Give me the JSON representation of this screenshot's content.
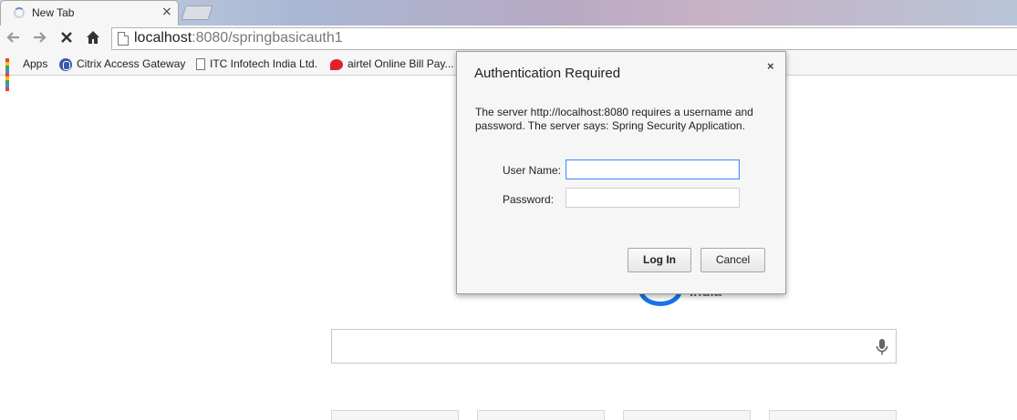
{
  "tab": {
    "title": "New Tab",
    "close": "×"
  },
  "toolbar": {
    "back_icon": "arrow-left-icon",
    "forward_icon": "arrow-right-icon",
    "stop_icon": "stop-icon",
    "home_icon": "home-icon",
    "url_host": "localhost",
    "url_rest": ":8080/springbasicauth1"
  },
  "bookmarks": [
    {
      "label": "Apps",
      "icon": "apps-grid-icon"
    },
    {
      "label": "Citrix Access Gateway",
      "icon": "citrix-icon"
    },
    {
      "label": "ITC Infotech India Ltd.",
      "icon": "page-icon"
    },
    {
      "label": "airtel Online Bill Pay...",
      "icon": "airtel-icon"
    }
  ],
  "page": {
    "logo_text": "India",
    "search_placeholder": ""
  },
  "dialog": {
    "title": "Authentication Required",
    "close": "×",
    "message": "The server http://localhost:8080 requires a username and password. The server says: Spring Security Application.",
    "username_label": "User Name:",
    "username_value": "",
    "password_label": "Password:",
    "password_value": "",
    "login_label": "Log In",
    "cancel_label": "Cancel"
  },
  "colors": {
    "focus_border": "#4d90fe",
    "logo_blue": "#1a73e8",
    "airtel_red": "#e0202a"
  }
}
